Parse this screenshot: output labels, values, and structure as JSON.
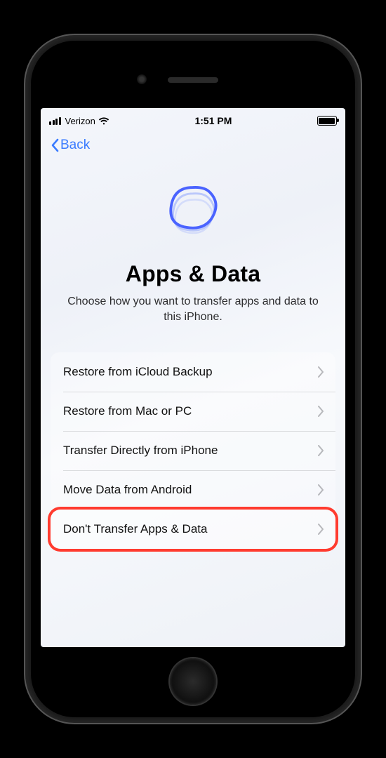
{
  "status_bar": {
    "carrier": "Verizon",
    "time": "1:51 PM"
  },
  "nav": {
    "back_label": "Back"
  },
  "page": {
    "title": "Apps & Data",
    "subtitle": "Choose how you want to transfer apps and data to this iPhone."
  },
  "options": [
    {
      "label": "Restore from iCloud Backup",
      "highlighted": false
    },
    {
      "label": "Restore from Mac or PC",
      "highlighted": false
    },
    {
      "label": "Transfer Directly from iPhone",
      "highlighted": false
    },
    {
      "label": "Move Data from Android",
      "highlighted": false
    },
    {
      "label": "Don't Transfer Apps & Data",
      "highlighted": true
    }
  ],
  "colors": {
    "tint": "#3a7bff",
    "highlight": "#ff3b2f"
  }
}
